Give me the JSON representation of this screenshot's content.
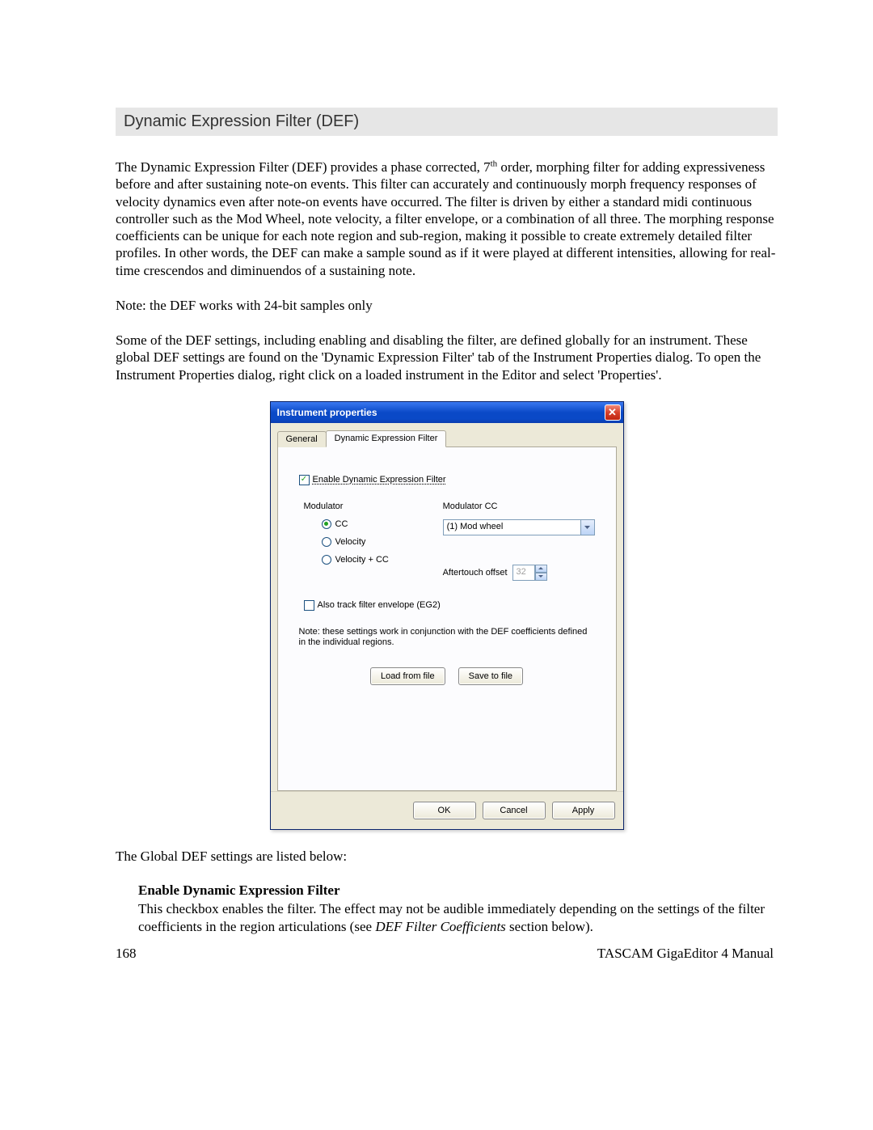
{
  "section_heading": "Dynamic Expression Filter (DEF)",
  "para1_a": "The Dynamic Expression Filter (DEF) provides a phase corrected, 7",
  "para1_sup": "th",
  "para1_b": " order, morphing filter for adding expressiveness before and after sustaining note-on events.  This filter can accurately and continuously morph frequency responses of velocity dynamics even after note-on events have occurred. The filter is driven by either a standard midi continuous controller such as the Mod Wheel, note velocity, a filter envelope, or a combination of all three.  The morphing response coefficients can be unique for each note region and sub-region, making it possible to create extremely detailed filter profiles. In other words, the DEF can make a sample sound as if it were played at different intensities, allowing for real-time crescendos and diminuendos of a sustaining note.",
  "note_line": "Note: the DEF works with 24-bit samples only",
  "para2": "Some of the DEF settings, including enabling and disabling the filter, are defined globally for an instrument. These global DEF settings are found on the 'Dynamic Expression Filter' tab of the Instrument Properties dialog. To open the Instrument Properties dialog, right click on a loaded instrument in the Editor and select 'Properties'.",
  "dialog": {
    "title": "Instrument properties",
    "tab_general": "General",
    "tab_def": "Dynamic Expression Filter",
    "enable_label": "Enable Dynamic Expression Filter",
    "modulator_label": "Modulator",
    "radio_cc": "CC",
    "radio_velocity": "Velocity",
    "radio_velcc": "Velocity + CC",
    "modulator_cc_label": "Modulator CC",
    "modulator_cc_value": "(1) Mod wheel",
    "aftertouch_label": "Aftertouch offset",
    "aftertouch_value": "32",
    "also_track_label": "Also track filter envelope (EG2)",
    "note_text": "Note: these settings work in conjunction with the DEF coefficients defined in the individual regions.",
    "load_btn": "Load from file",
    "save_btn": "Save to file",
    "ok_btn": "OK",
    "cancel_btn": "Cancel",
    "apply_btn": "Apply"
  },
  "para3": "The Global DEF settings are listed below:",
  "sub_heading": "Enable Dynamic Expression Filter",
  "sub_body_a": "This checkbox enables the filter.  The effect may not be audible immediately depending on the settings of the filter coefficients in the region articulations (see ",
  "sub_body_ital": "DEF Filter Coefficients",
  "sub_body_b": " section below).",
  "footer": {
    "page": "168",
    "manual": "TASCAM GigaEditor 4 Manual"
  }
}
